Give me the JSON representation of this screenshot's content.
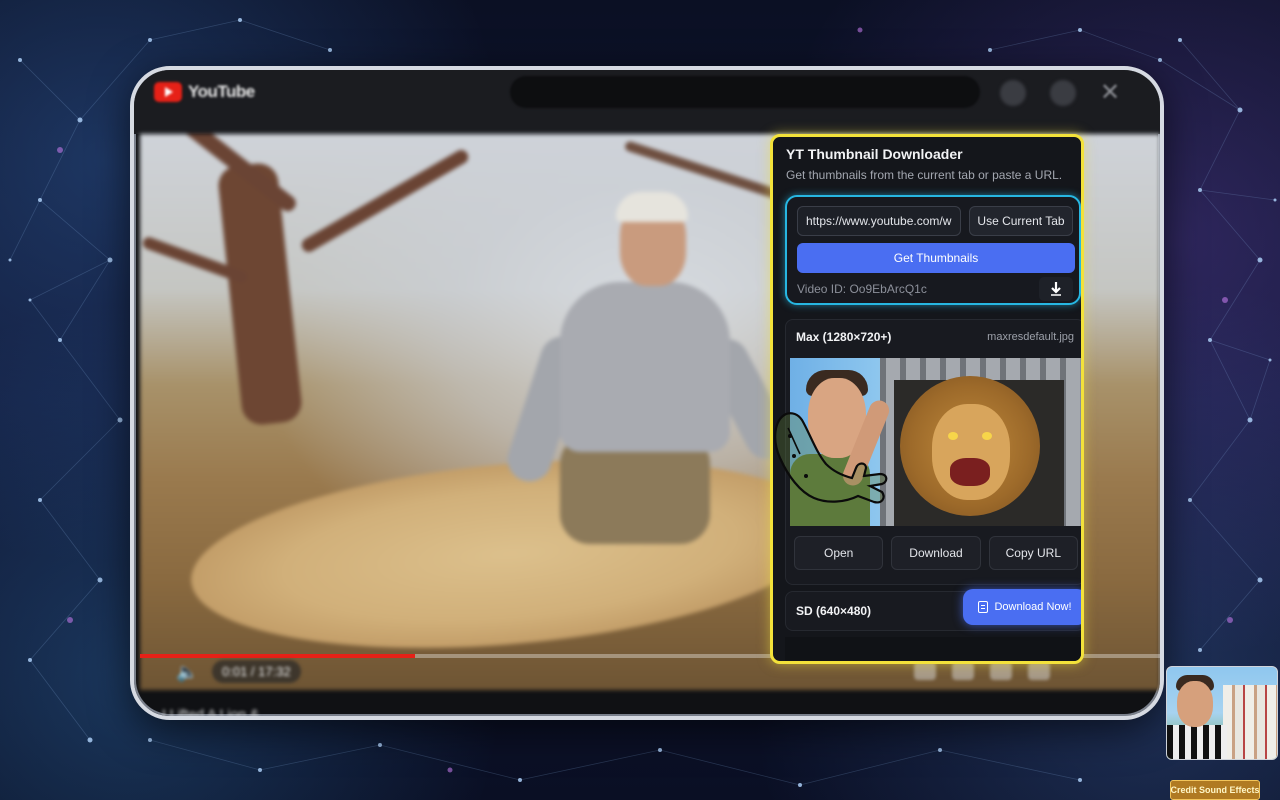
{
  "youtube": {
    "logo_text": "YouTube",
    "video_time": "0:01 / 17:32",
    "progress_fraction": 0.27,
    "video_title_partial": "I Lifted A Lion & ..."
  },
  "extension": {
    "title": "YT Thumbnail Downloader",
    "subtitle": "Get thumbnails from the current tab or paste a URL.",
    "url_value": "https://www.youtube.com/w",
    "use_current_tab_label": "Use Current Tab",
    "get_thumbnails_label": "Get Thumbnails",
    "video_id_text": "Video ID: Oo9EbArcQ1c",
    "thumbnails": [
      {
        "label": "Max (1280×720+)",
        "filename": "maxresdefault.jpg",
        "actions": {
          "open": "Open",
          "download": "Download",
          "copy_url": "Copy URL"
        }
      },
      {
        "label": "SD (640×480)"
      }
    ],
    "download_now_label": "Download Now!"
  },
  "colors": {
    "panel_border": "#f3e23a",
    "url_card_border": "#27b7e2",
    "primary_button": "#4a6ef2",
    "youtube_red": "#e62117"
  },
  "corner_tag": "Credit Sound Effects"
}
